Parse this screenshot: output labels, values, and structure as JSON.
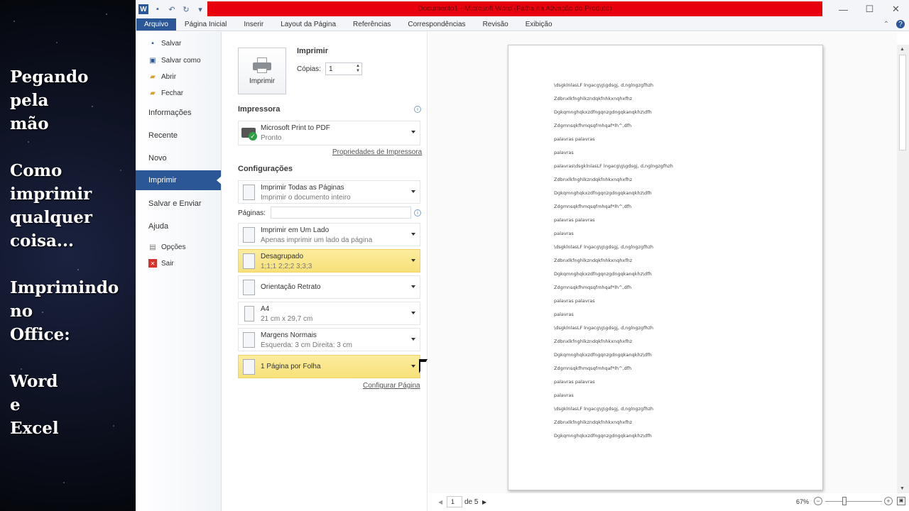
{
  "overlay": {
    "block1": "Pegando\npela\nmão",
    "block2": "Como\nimprimir\nqualquer\ncoisa...",
    "block3": "Imprimindo\nno\nOffice:",
    "block4": "Word\ne\nExcel"
  },
  "window": {
    "title": "Documento1 - Microsoft Word (Falha na Ativação do Produto)",
    "app_icon_letter": "W",
    "title_bar_color": "#e8000d"
  },
  "ribbon": {
    "tabs": [
      "Arquivo",
      "Página Inicial",
      "Inserir",
      "Layout da Página",
      "Referências",
      "Correspondências",
      "Revisão",
      "Exibição"
    ],
    "accent": "#2b5797"
  },
  "backstage": {
    "salvar": "Salvar",
    "salvar_como": "Salvar como",
    "abrir": "Abrir",
    "fechar": "Fechar",
    "informacoes": "Informações",
    "recente": "Recente",
    "novo": "Novo",
    "imprimir": "Imprimir",
    "salvar_enviar": "Salvar e Enviar",
    "ajuda": "Ajuda",
    "opcoes": "Opções",
    "sair": "Sair"
  },
  "print": {
    "button_label": "Imprimir",
    "heading": "Imprimir",
    "copies_label": "Cópias:",
    "copies_value": "1",
    "printer_section": "Impressora",
    "printer_name": "Microsoft Print to PDF",
    "printer_status": "Pronto",
    "printer_properties": "Propriedades de Impressora",
    "settings_section": "Configurações",
    "pages_label": "Páginas:",
    "pages_value": "",
    "setting1_main": "Imprimir Todas as Páginas",
    "setting1_sub": "Imprimir o documento inteiro",
    "setting2_main": "Imprimir em Um Lado",
    "setting2_sub": "Apenas imprimir um lado da página",
    "setting3_main": "Desagrupado",
    "setting3_sub": "1;1;1    2;2;2    3;3;3",
    "setting4_main": "Orientação Retrato",
    "setting5_main": "A4",
    "setting5_sub": "21 cm x 29,7 cm",
    "setting6_main": "Margens Normais",
    "setting6_sub": "Esquerda:  3 cm    Direita:  3 cm",
    "setting7_main": "1 Página por Folha",
    "page_setup_link": "Configurar Página",
    "highlight_color": "#f8e17a"
  },
  "preview": {
    "lines": [
      "\\dsgklnlasLF lngacg\\g\\gdsgj, d,nglngzgfhzh",
      "Zdbnxlkfnghlkzndqkfnhkxnqhxfhz",
      "Dgkqmnghqkxzdfngqnzgdngqkanqkhz\\dfh",
      "Zdgmnsqkfhmqsqfmhqaf*lh^,dfh",
      "palavras palavras",
      "palavras",
      "palavras\\dsgklnlasLF lngacg\\g\\gdsgj, d,nglngzgfhzh",
      "Zdbnxlkfnghlkzndqkfnhkxnqhxfhz",
      "Dgkqmnghqkxzdfngqnzgdngqkanqkhz\\dfh",
      "Zdgmnsqkfhmqsqfmhqaf*lh^,dfh",
      "palavras palavras",
      "palavras",
      "\\dsgklnlasLF lngacg\\g\\gdsgj, d,nglngzgfhzh",
      "Zdbnxlkfnghlkzndqkfnhkxnqhxfhz",
      "Dgkqmnghqkxzdfngqnzgdngqkanqkhz\\dfh",
      "Zdgmnsqkfhmqsqfmhqaf*lh^,dfh",
      "palavras palavras",
      "palavras",
      "\\dsgklnlasLF lngacg\\g\\gdsgj, d,nglngzgfhzh",
      "Zdbnxlkfnghlkzndqkfnhkxnqhxfhz",
      "Dgkqmnghqkxzdfngqnzgdngqkanqkhz\\dfh",
      "Zdgmnsqkfhmqsqfmhqaf*lh^,dfh",
      "palavras palavras",
      "palavras",
      "\\dsgklnlasLF lngacg\\g\\gdsgj, d,nglngzgfhzh",
      "Zdbnxlkfnghlkzndqkfnhkxnqhxfhz",
      "Dgkqmnghqkxzdfngqnzgdngqkanqkhz\\dfh"
    ]
  },
  "statusbar": {
    "page_current": "1",
    "page_total": "de 5",
    "zoom": "67%"
  },
  "icons": {
    "save": "save-icon",
    "undo": "undo-icon",
    "redo": "redo-icon",
    "printer": "printer-icon",
    "info": "info-icon"
  }
}
